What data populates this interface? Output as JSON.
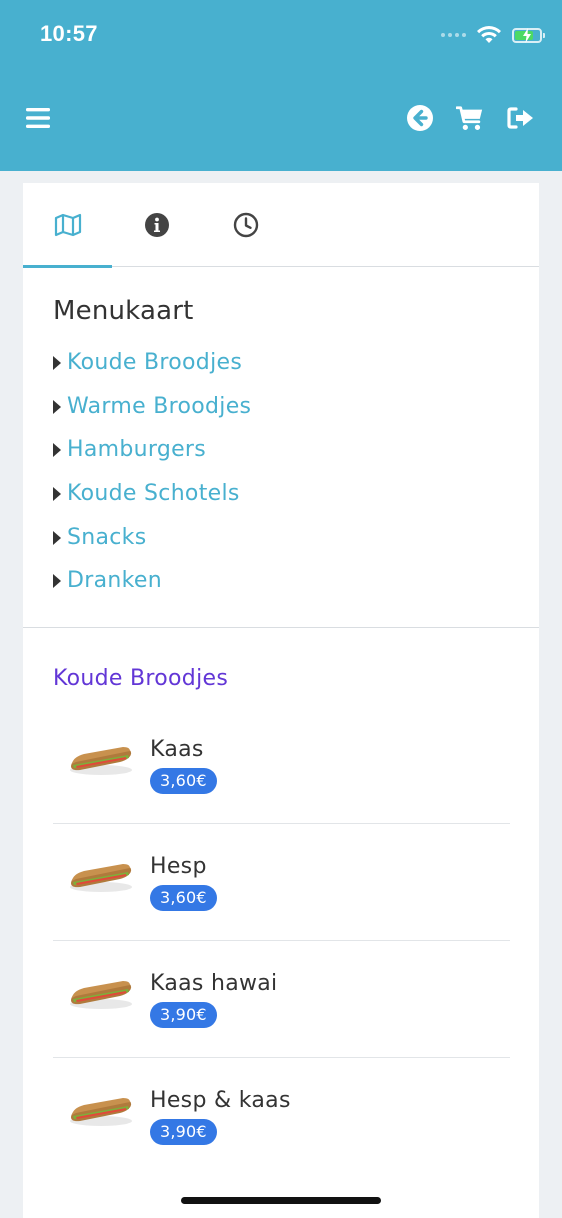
{
  "status_bar": {
    "time": "10:57"
  },
  "header": {
    "menu_icon": "hamburger-icon",
    "back_icon": "arrow-circle-left-icon",
    "cart_icon": "shopping-cart-icon",
    "logout_icon": "sign-out-icon",
    "background_color": "#48b0cf"
  },
  "tabs": [
    {
      "icon": "map-icon",
      "active": true
    },
    {
      "icon": "info-icon",
      "active": false
    },
    {
      "icon": "clock-icon",
      "active": false
    }
  ],
  "menu": {
    "title": "Menukaart",
    "items": [
      "Koude Broodjes",
      "Warme Broodjes",
      "Hamburgers",
      "Koude Schotels",
      "Snacks",
      "Dranken"
    ]
  },
  "category": {
    "title": "Koude Broodjes",
    "products": [
      {
        "name": "Kaas",
        "price": "3,60€",
        "image_icon": "sandwich-icon"
      },
      {
        "name": "Hesp",
        "price": "3,60€",
        "image_icon": "sandwich-icon"
      },
      {
        "name": "Kaas hawai",
        "price": "3,90€",
        "image_icon": "sandwich-icon"
      },
      {
        "name": "Hesp & kaas",
        "price": "3,90€",
        "image_icon": "sandwich-icon"
      }
    ]
  },
  "colors": {
    "accent": "#48b0cf",
    "category_title": "#6236d6",
    "price_badge": "#3478e5"
  }
}
